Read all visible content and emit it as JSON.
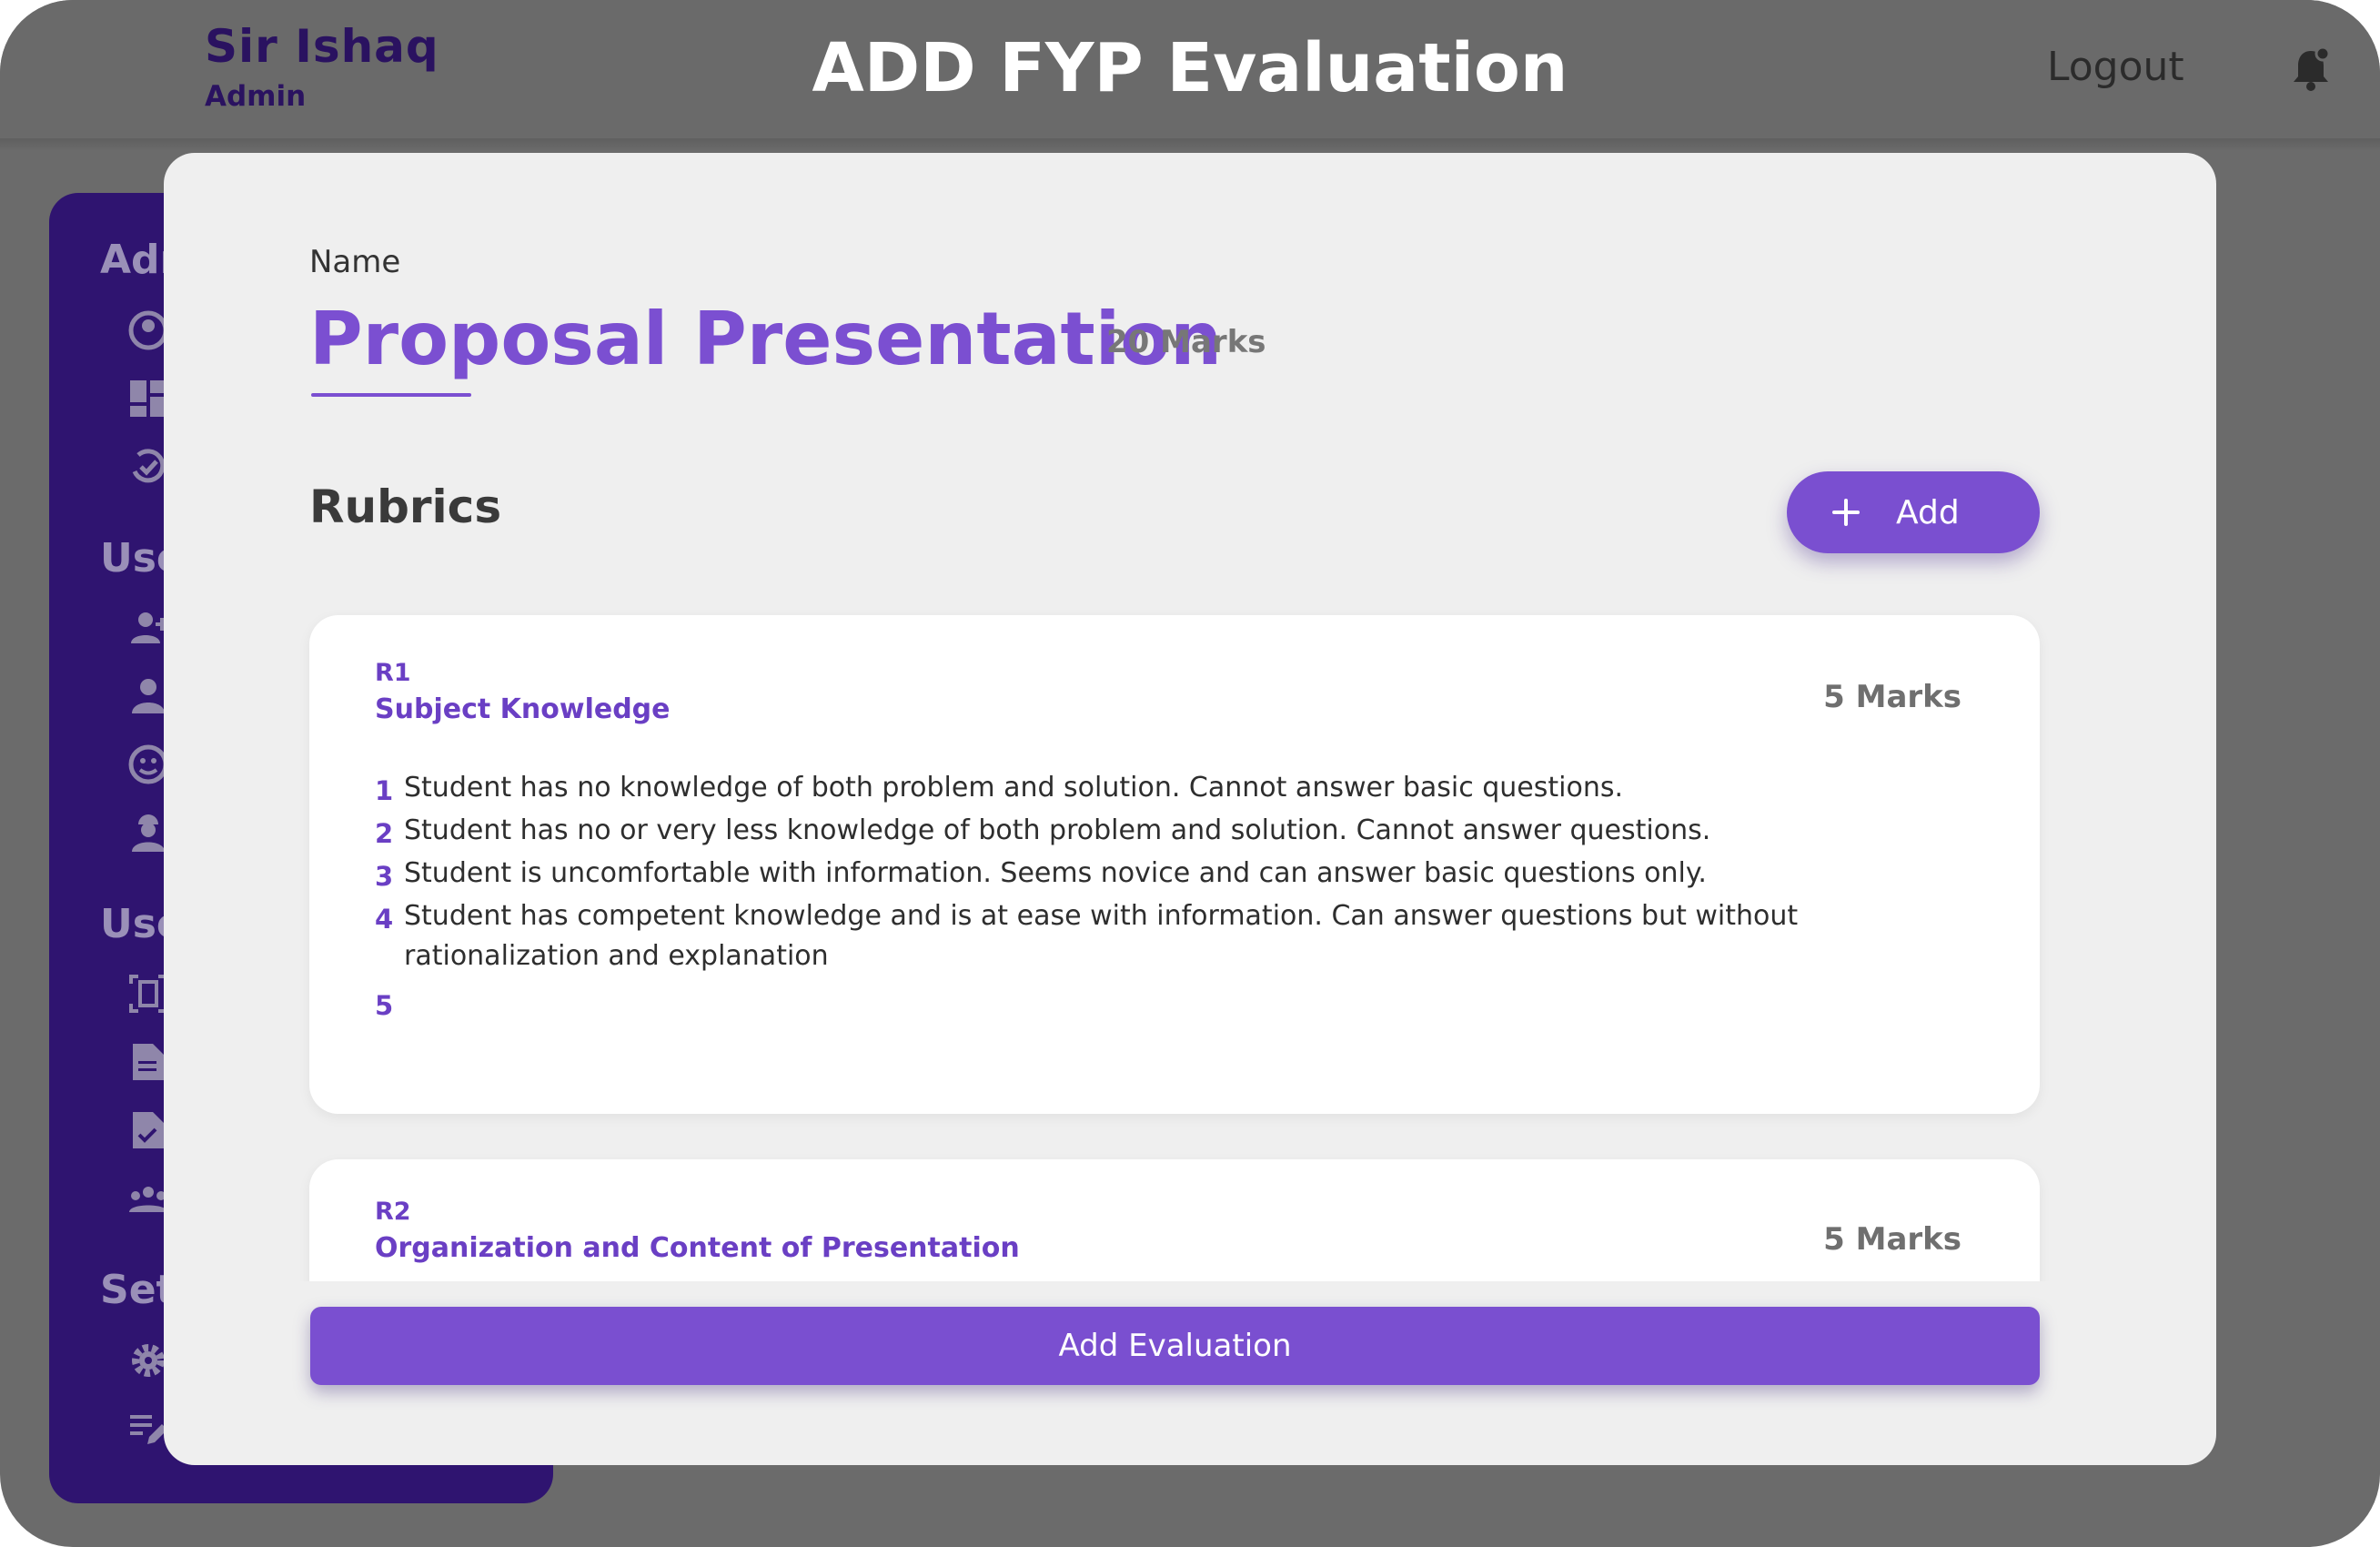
{
  "header": {
    "user_name": "Sir Ishaq",
    "user_role": "Admin",
    "title": "ADD FYP Evaluation",
    "logout_label": "Logout"
  },
  "sidebar": {
    "sections": [
      "Adm",
      "Use",
      "Use",
      "Set"
    ]
  },
  "modal": {
    "name_label": "Name",
    "evaluation_name": "Proposal Presentation",
    "evaluation_marks": "20 Marks",
    "rubrics_title": "Rubrics",
    "add_label": "Add",
    "submit_label": "Add Evaluation",
    "rubrics": [
      {
        "id": "R1",
        "name": "Subject Knowledge",
        "marks": "5 Marks",
        "levels": [
          {
            "n": "1",
            "text": "Student has no knowledge of both problem and solution. Cannot answer basic questions."
          },
          {
            "n": "2",
            "text": "Student has no or very less knowledge of both problem and solution. Cannot answer questions."
          },
          {
            "n": "3",
            "text": "Student is uncomfortable with information. Seems novice and can answer basic questions only."
          },
          {
            "n": "4",
            "text": "Student has competent knowledge and is at ease with information. Can answer questions but without rationalization and explanation"
          },
          {
            "n": "5",
            "text": ""
          }
        ]
      },
      {
        "id": "R2",
        "name": "Organization and Content of Presentation",
        "marks": "5 Marks"
      }
    ]
  },
  "colors": {
    "accent": "#7a4fd0",
    "sidebar": "#2f1470",
    "overlay": "#6b6b6b"
  }
}
